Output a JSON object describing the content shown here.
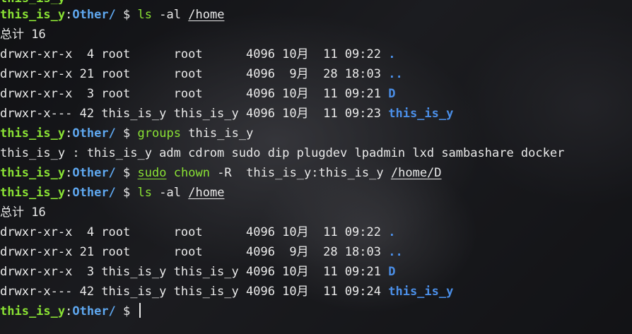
{
  "prompt": {
    "user": "this_is_y",
    "sep": ":",
    "dir": "Other/",
    "sym": "$"
  },
  "commands": {
    "c1": {
      "name": "ls",
      "args": "-al",
      "path": "/home"
    },
    "c2": {
      "name": "groups",
      "args": "this_is_y"
    },
    "c3": {
      "name": "sudo",
      "name2": "chown",
      "args": "-R",
      "args2": "this_is_y:this_is_y",
      "path": "/home/D"
    },
    "c4": {
      "name": "ls",
      "args": "-al",
      "path": "/home"
    }
  },
  "listing1": {
    "total": "总计 16",
    "rows": [
      {
        "text": "drwxr-xr-x  4 root      root      4096 10月  11 09:22",
        "name": "."
      },
      {
        "text": "drwxr-xr-x 21 root      root      4096  9月  28 18:03",
        "name": ".."
      },
      {
        "text": "drwxr-xr-x  3 root      root      4096 10月  11 09:21",
        "name": "D"
      },
      {
        "text": "drwxr-x--- 42 this_is_y this_is_y 4096 10月  11 09:23",
        "name": "this_is_y"
      }
    ]
  },
  "groups_output": "this_is_y : this_is_y adm cdrom sudo dip plugdev lpadmin lxd sambashare docker",
  "listing2": {
    "total": "总计 16",
    "rows": [
      {
        "text": "drwxr-xr-x  4 root      root      4096 10月  11 09:22",
        "name": "."
      },
      {
        "text": "drwxr-xr-x 21 root      root      4096  9月  28 18:03",
        "name": ".."
      },
      {
        "text": "drwxr-xr-x  3 this_is_y this_is_y 4096 10月  11 09:21",
        "name": "D"
      },
      {
        "text": "drwxr-x--- 42 this_is_y this_is_y 4096 10月  11 09:24",
        "name": "this_is_y"
      }
    ]
  },
  "colors": {
    "user": "#8ae234",
    "path": "#5fa8f0",
    "dir": "#4b8fe8",
    "text": "#eaeaea"
  }
}
